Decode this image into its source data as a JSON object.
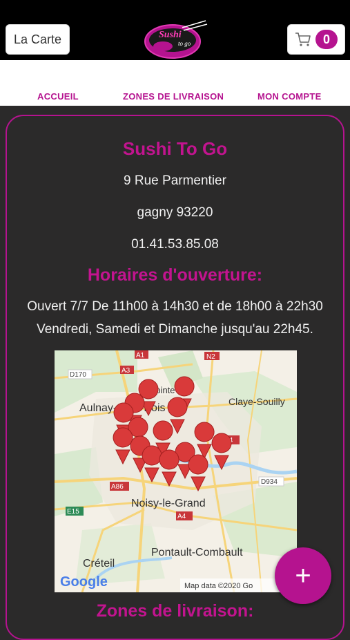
{
  "header": {
    "menu_button_label": "La Carte",
    "logo_text_main": "Sushi",
    "logo_text_sub": "to go",
    "cart_count": "0"
  },
  "nav": {
    "items": [
      {
        "label": "ACCUEIL"
      },
      {
        "label": "ZONES DE LIVRAISON"
      },
      {
        "label": "MON COMPTE"
      }
    ]
  },
  "restaurant": {
    "name": "Sushi To Go",
    "street": "9 Rue Parmentier",
    "city": "gagny 93220",
    "phone": "01.41.53.85.08"
  },
  "hours": {
    "heading": "Horaires d'ouverture:",
    "line1": "Ouvert 7/7 De 11h00 à 14h30 et de 18h00 à 22h30",
    "line2": "Vendredi, Samedi et Dimanche jusqu'au 22h45."
  },
  "map": {
    "labels": {
      "a1": "A1",
      "n2": "N2",
      "a3": "A3",
      "d170": "D170",
      "villepinte": "Villepinte",
      "aulnay": "Aulnay-sous-Bois",
      "clayesouilly": "Claye-Souilly",
      "a104": "A104",
      "a86": "A86",
      "d934": "D934",
      "e15": "E15",
      "noisy": "Noisy-le-Grand",
      "a4": "A4",
      "pontault": "Pontault-Combault",
      "creteil": "Créteil"
    },
    "google": "Google",
    "attribution": "Map data ©2020 Go",
    "pin_color": "#d93a3a"
  },
  "zones": {
    "heading": "Zones de livraison:"
  },
  "fab": {
    "icon": "plus-icon",
    "symbol": "+"
  },
  "colors": {
    "accent": "#b5138f",
    "background": "#2b2a2a"
  }
}
